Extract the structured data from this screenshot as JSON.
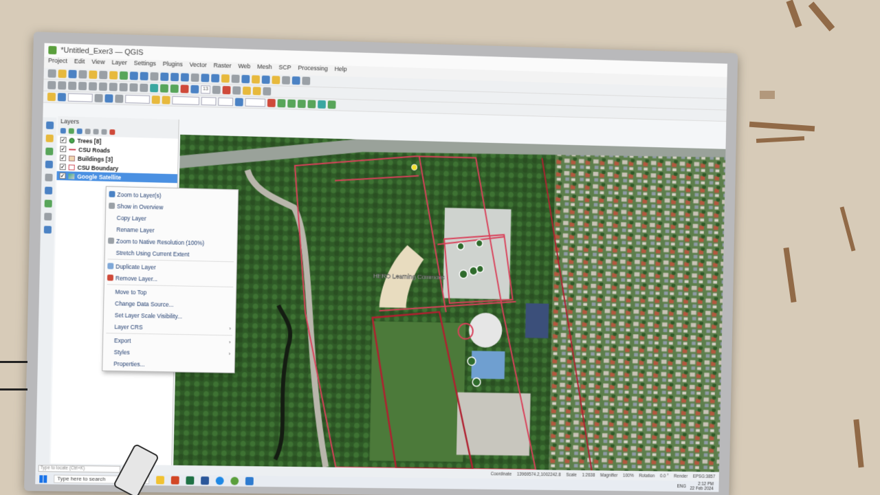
{
  "window": {
    "title": "*Untitled_Exer3 — QGIS"
  },
  "menu": [
    "Project",
    "Edit",
    "View",
    "Layer",
    "Settings",
    "Plugins",
    "Vector",
    "Raster",
    "Web",
    "Mesh",
    "SCP",
    "Processing",
    "Help"
  ],
  "layers_panel": {
    "title": "Layers",
    "layers": [
      {
        "name": "Trees [8]",
        "checked": true,
        "symbol": "point"
      },
      {
        "name": "CSU Roads",
        "checked": true,
        "symbol": "line"
      },
      {
        "name": "Buildings [3]",
        "checked": true,
        "symbol": "polygon"
      },
      {
        "name": "CSU Boundary",
        "checked": true,
        "symbol": "boundary"
      },
      {
        "name": "Google Satellite",
        "checked": true,
        "symbol": "raster",
        "selected": true
      }
    ]
  },
  "context_menu": [
    {
      "label": "Zoom to Layer(s)",
      "icon": "zoom-layer-icon"
    },
    {
      "label": "Show in Overview",
      "icon": "overview-icon"
    },
    {
      "label": "Copy Layer"
    },
    {
      "label": "Rename Layer"
    },
    {
      "label": "Zoom to Native Resolution (100%)",
      "icon": "zoom-native-icon"
    },
    {
      "label": "Stretch Using Current Extent"
    },
    {
      "separator": true
    },
    {
      "label": "Duplicate Layer",
      "icon": "duplicate-icon"
    },
    {
      "label": "Remove Layer...",
      "icon": "remove-icon"
    },
    {
      "separator": true
    },
    {
      "label": "Move to Top"
    },
    {
      "label": "Change Data Source..."
    },
    {
      "label": "Set Layer Scale Visibility..."
    },
    {
      "label": "Layer CRS",
      "submenu": true
    },
    {
      "separator": true
    },
    {
      "label": "Export",
      "submenu": true
    },
    {
      "label": "Styles",
      "submenu": true
    },
    {
      "label": "Properties..."
    }
  ],
  "map": {
    "label": "HERO Learning Commons",
    "boundary_color": "#d9415a"
  },
  "toolbar": {
    "scale_value": "1:2638",
    "magnifier": "100%",
    "rotation": "0.0 °",
    "zoom_field": "13"
  },
  "statusbar": {
    "locator_placeholder": "Type to locate (Ctrl+K)",
    "coordinate_label": "Coordinate",
    "coordinate": "13969574.2,1002242.8",
    "scale_label": "Scale",
    "scale": "1:2638",
    "magnifier_label": "Magnifier",
    "magnifier": "100%",
    "rotation_label": "Rotation",
    "rotation": "0.0 °",
    "render_label": "Render",
    "crs": "EPSG:3857"
  },
  "taskbar": {
    "search_placeholder": "Type here to search",
    "lang": "ENG",
    "time": "2:12 PM",
    "date": "22 Feb 2024"
  }
}
